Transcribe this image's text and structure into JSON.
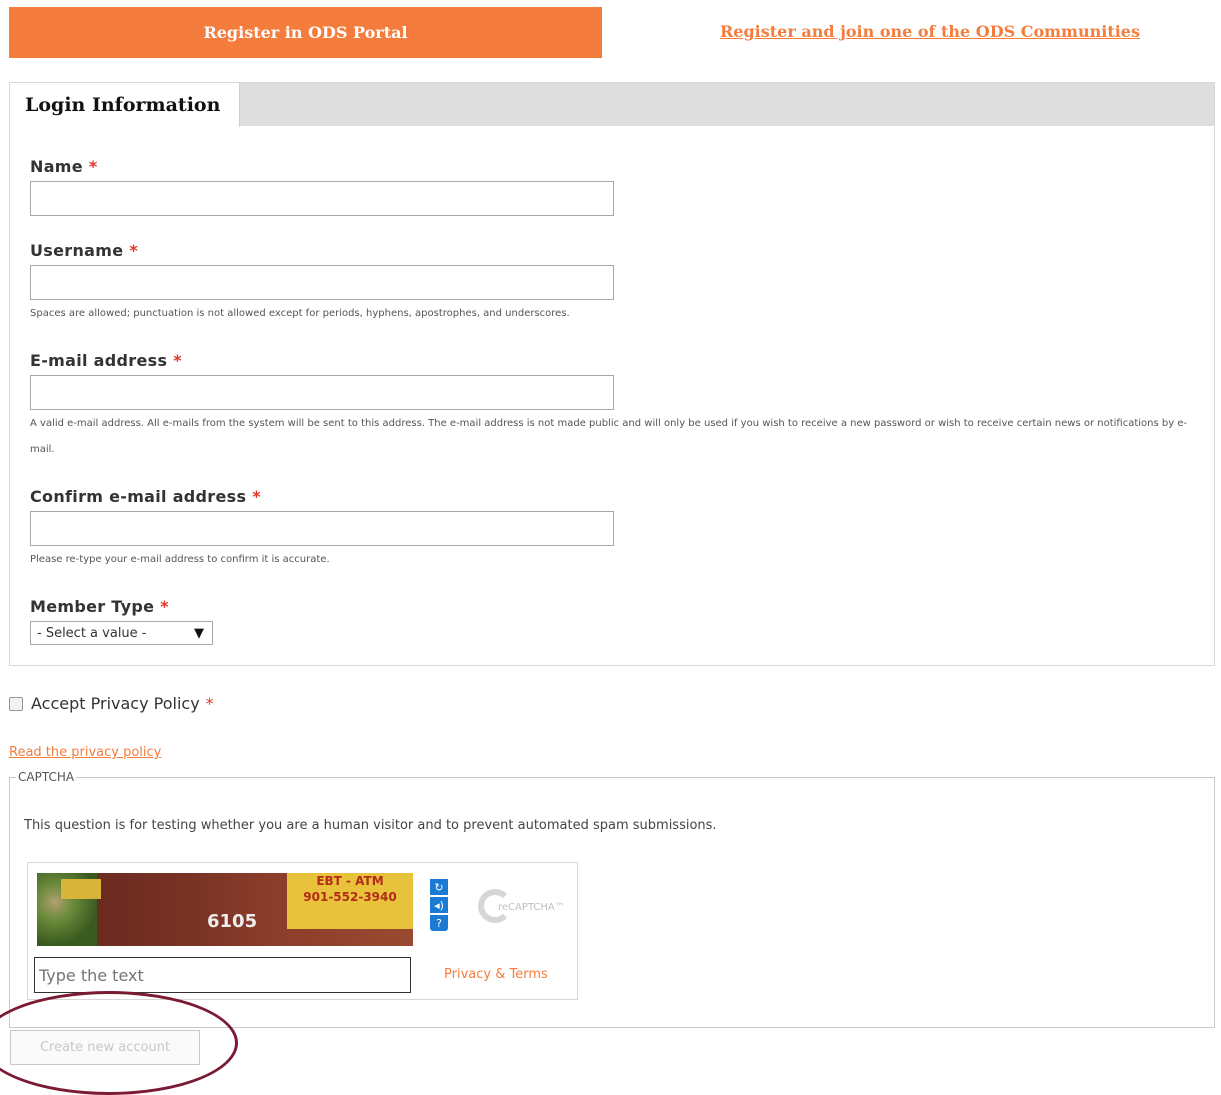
{
  "header": {
    "register_button": "Register in ODS Portal",
    "communities_link": "Register and join one of the ODS Communities"
  },
  "login": {
    "tab_label": "Login Information",
    "required_marker": "*",
    "name_label": "Name",
    "username_label": "Username",
    "username_help": "Spaces are allowed; punctuation is not allowed except for periods, hyphens, apostrophes, and underscores.",
    "email_label": "E-mail address",
    "email_help": "A valid e-mail address. All e-mails from the system will be sent to this address. The e-mail address is not made public and will only be used if you wish to receive a new password or wish to receive certain news or notifications by e-mail.",
    "confirm_label": "Confirm e-mail address",
    "confirm_help": "Please re-type your e-mail address to confirm it is accurate.",
    "member_type_label": "Member Type",
    "member_type_selected": "- Select a value -",
    "select_arrow": "▼"
  },
  "privacy": {
    "accept_label": "Accept Privacy Policy",
    "read_link": "Read the privacy policy"
  },
  "captcha": {
    "legend": "CAPTCHA",
    "description": "This question is for testing whether you are a human visitor and to prevent automated spam submissions.",
    "image_sign": "EBT - ATM",
    "image_sign_phone": "901-552-3940",
    "image_number": "6105",
    "refresh_icon": "↻",
    "audio_icon": "◂)",
    "help_icon": "?",
    "logo_text": "reCAPTCHA™",
    "input_placeholder": "Type the text",
    "terms_link": "Privacy & Terms"
  },
  "submit": {
    "label": "Create new account"
  },
  "colors": {
    "accent": "#f47c3c",
    "required": "#e0362c",
    "annotation": "#7a1a33"
  }
}
